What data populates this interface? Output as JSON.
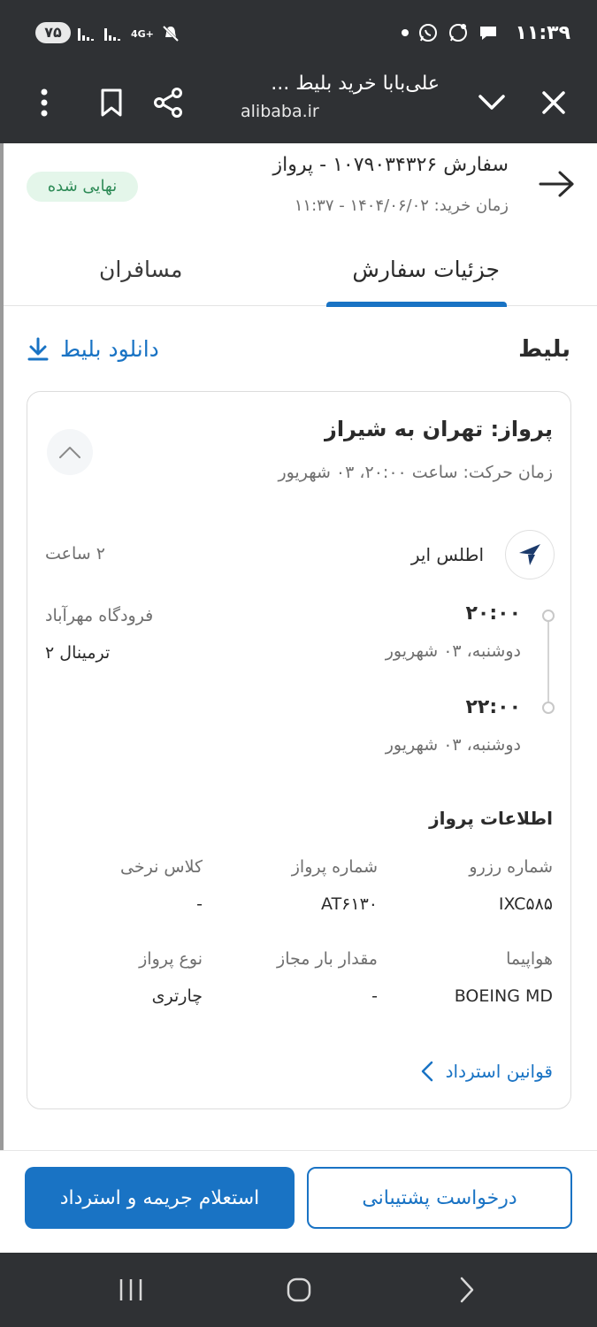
{
  "status_bar": {
    "battery": "۷۵",
    "network": "4G+",
    "time": "۱۱:۳۹"
  },
  "browser": {
    "title": "علی‌بابا خرید بلیط ...",
    "url": "alibaba.ir"
  },
  "order": {
    "title": "سفارش ۱۰۷۹۰۳۴۳۲۶ - پرواز",
    "purchase_time": "زمان خرید: ۱۴۰۴/۰۶/۰۲ - ۱۱:۳۷",
    "status": "نهایی شده"
  },
  "tabs": [
    {
      "label": "جزئیات سفارش",
      "active": true
    },
    {
      "label": "مسافران",
      "active": false
    }
  ],
  "ticket": {
    "section_title": "بلیط",
    "download_label": "دانلود بلیط"
  },
  "flight": {
    "title": "پرواز: تهران به شیراز",
    "departure_time": "زمان حرکت: ساعت ۲۰:۰۰، ۰۳ شهریور",
    "airline": "اطلس ایر",
    "duration": "۲ ساعت",
    "departure": {
      "time": "۲۰:۰۰",
      "date": "دوشنبه، ۰۳ شهریور"
    },
    "arrival": {
      "time": "۲۲:۰۰",
      "date": "دوشنبه، ۰۳ شهریور"
    },
    "airport": "فرودگاه مهرآباد",
    "terminal": "ترمینال ۲"
  },
  "flight_info": {
    "title": "اطلاعات پرواز",
    "fields": [
      {
        "label": "شماره رزرو",
        "value": "IXC۵۸۵"
      },
      {
        "label": "شماره پرواز",
        "value": "AT۶۱۳۰"
      },
      {
        "label": "کلاس نرخی",
        "value": "-"
      },
      {
        "label": "هواپیما",
        "value": "BOEING MD"
      },
      {
        "label": "مقدار بار مجاز",
        "value": "-"
      },
      {
        "label": "نوع پرواز",
        "value": "چارتری"
      }
    ]
  },
  "refund_rules_label": "قوانین استرداد",
  "buttons": {
    "support": "درخواست پشتیبانی",
    "refund": "استعلام جریمه و استرداد"
  },
  "colors": {
    "primary": "#1973c4",
    "success_bg": "#e4f6ea",
    "success_text": "#2e8b57",
    "dark_bar": "#2f3134"
  }
}
